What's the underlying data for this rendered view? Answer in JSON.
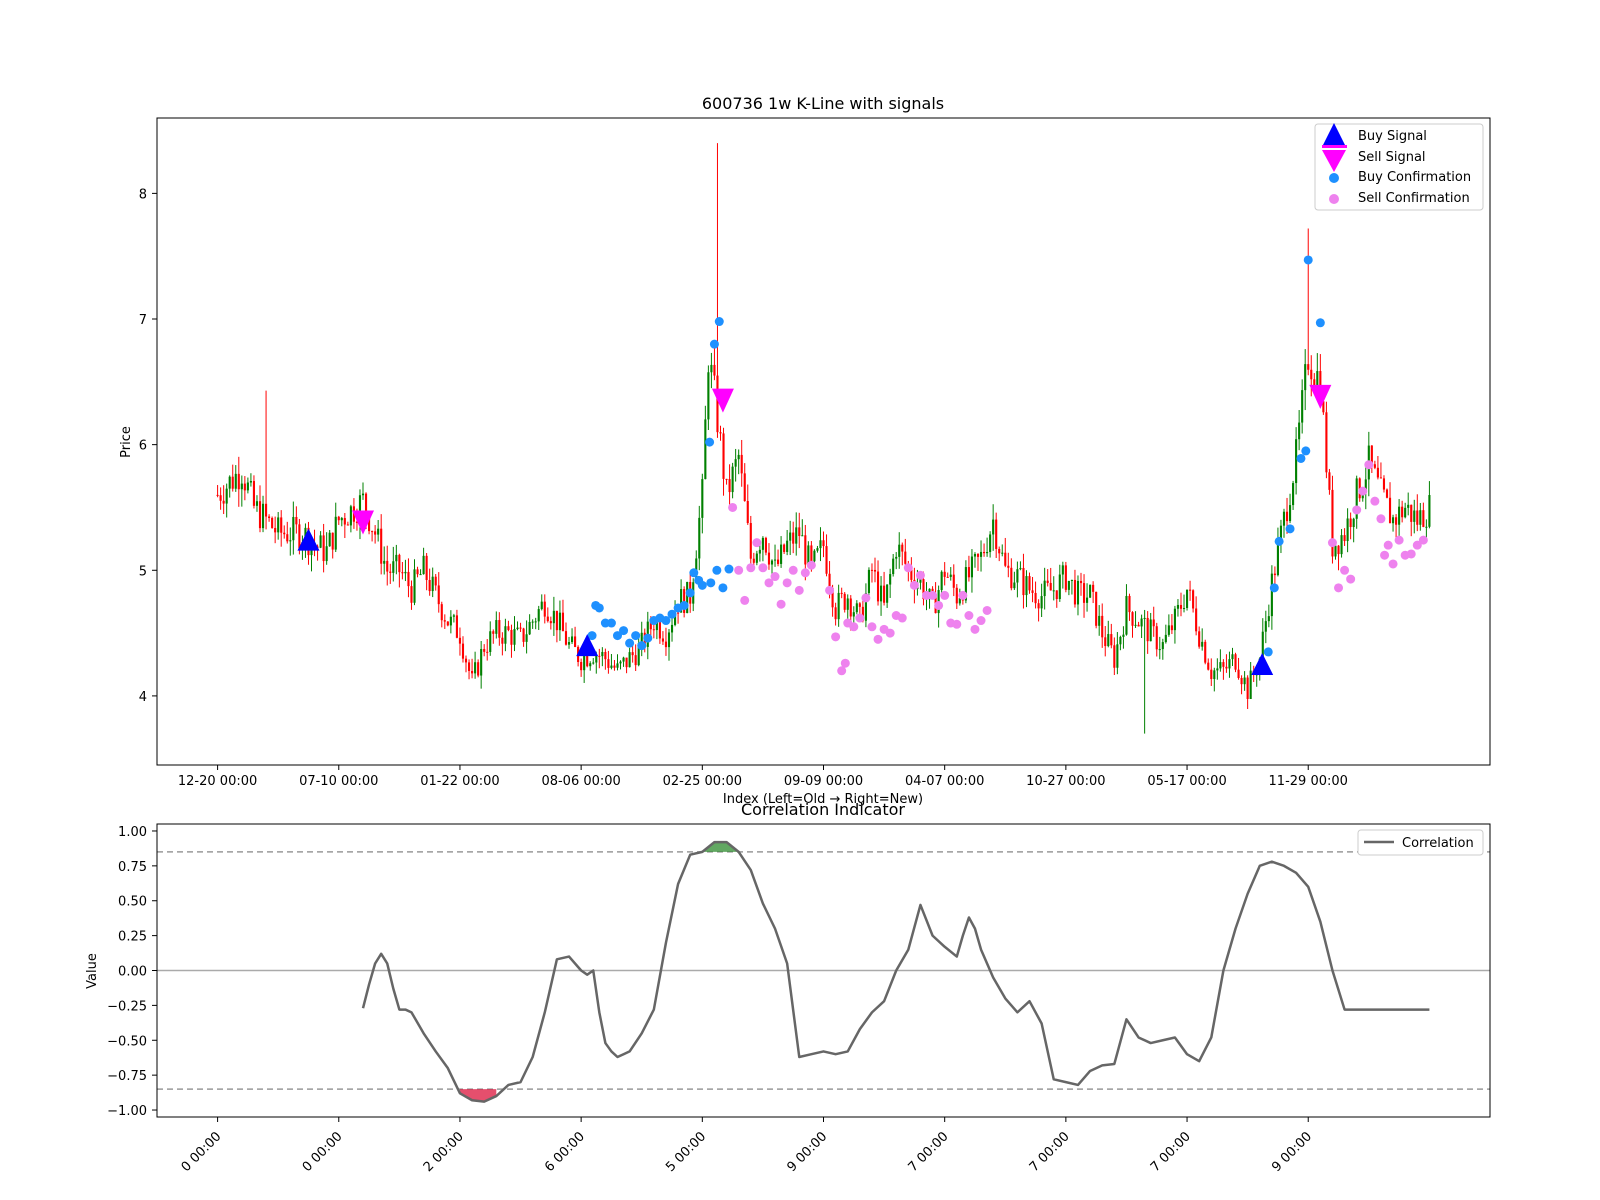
{
  "colors": {
    "up_candle": "#008000",
    "down_candle": "#ff0000",
    "buy_signal": "#0000ff",
    "sell_signal": "#ff00ff",
    "buy_confirmation": "#1e90ff",
    "sell_confirmation": "#ee82ee",
    "correlation_line": "#666666",
    "threshold_line": "#999999",
    "zero_line": "#aaaaaa",
    "high_fill": "#2e8b2e",
    "low_fill": "#dc143c"
  },
  "chart_data": [
    {
      "type": "candlestick",
      "title": "600736 1w K-Line with signals",
      "xlabel": "Index (Left=Old → Right=New)",
      "ylabel": "Price",
      "ylim": [
        3.45,
        8.6
      ],
      "xlim": [
        -5,
        105
      ],
      "yticks": [
        4,
        5,
        6,
        7,
        8
      ],
      "xtick_positions": [
        0,
        10,
        20,
        30,
        40,
        50,
        60,
        70,
        80,
        90
      ],
      "xtick_labels": [
        "12-20 00:00",
        "07-10 00:00",
        "01-22 00:00",
        "08-06 00:00",
        "02-25 00:00",
        "09-09 00:00",
        "04-07 00:00",
        "10-27 00:00",
        "05-17 00:00",
        "11-29 00:00"
      ],
      "close_anchors": [
        [
          0,
          5.6
        ],
        [
          2,
          5.8
        ],
        [
          3,
          5.5
        ],
        [
          5,
          5.3
        ],
        [
          7,
          5.3
        ],
        [
          8,
          5.2
        ],
        [
          9,
          5.15
        ],
        [
          10,
          5.4
        ],
        [
          12,
          5.55
        ],
        [
          13,
          5.3
        ],
        [
          14,
          5.0
        ],
        [
          15,
          5.0
        ],
        [
          16,
          4.85
        ],
        [
          17,
          5.0
        ],
        [
          18,
          4.8
        ],
        [
          19,
          4.6
        ],
        [
          20,
          4.5
        ],
        [
          21,
          4.1
        ],
        [
          22,
          4.4
        ],
        [
          23,
          4.5
        ],
        [
          24,
          4.5
        ],
        [
          25,
          4.45
        ],
        [
          26,
          4.6
        ],
        [
          27,
          4.75
        ],
        [
          28,
          4.6
        ],
        [
          29,
          4.4
        ],
        [
          30,
          4.3
        ],
        [
          31,
          4.35
        ],
        [
          32,
          4.3
        ],
        [
          33,
          4.2
        ],
        [
          34,
          4.3
        ],
        [
          35,
          4.4
        ],
        [
          36,
          4.6
        ],
        [
          37,
          4.5
        ],
        [
          38,
          4.75
        ],
        [
          39,
          4.8
        ],
        [
          40,
          5.6
        ],
        [
          40.5,
          6.7
        ],
        [
          41,
          6.4
        ],
        [
          41.5,
          6.0
        ],
        [
          42,
          5.6
        ],
        [
          43,
          5.9
        ],
        [
          44,
          5.1
        ],
        [
          45,
          5.3
        ],
        [
          46,
          5.0
        ],
        [
          47,
          5.2
        ],
        [
          48,
          5.3
        ],
        [
          49,
          5.0
        ],
        [
          50,
          5.2
        ],
        [
          51,
          4.7
        ],
        [
          52,
          4.8
        ],
        [
          53,
          4.6
        ],
        [
          54,
          5.0
        ],
        [
          55,
          4.7
        ],
        [
          56,
          5.2
        ],
        [
          57,
          5.0
        ],
        [
          58,
          4.9
        ],
        [
          59,
          4.7
        ],
        [
          60,
          5.0
        ],
        [
          61,
          4.8
        ],
        [
          62,
          4.95
        ],
        [
          63,
          5.1
        ],
        [
          64,
          5.4
        ],
        [
          65,
          5.0
        ],
        [
          66,
          4.95
        ],
        [
          67,
          4.85
        ],
        [
          68,
          4.8
        ],
        [
          69,
          4.85
        ],
        [
          70,
          4.95
        ],
        [
          71,
          4.8
        ],
        [
          72,
          4.8
        ],
        [
          73,
          4.5
        ],
        [
          74,
          4.3
        ],
        [
          75,
          4.7
        ],
        [
          76,
          4.6
        ],
        [
          77,
          4.5
        ],
        [
          78,
          4.4
        ],
        [
          79,
          4.6
        ],
        [
          80,
          4.85
        ],
        [
          81,
          4.5
        ],
        [
          82,
          4.2
        ],
        [
          83,
          4.2
        ],
        [
          84,
          4.3
        ],
        [
          85,
          4.05
        ],
        [
          86,
          4.3
        ],
        [
          87,
          4.9
        ],
        [
          88,
          5.4
        ],
        [
          89,
          5.9
        ],
        [
          90,
          6.7
        ],
        [
          91,
          6.5
        ],
        [
          92,
          5.2
        ],
        [
          93,
          5.3
        ],
        [
          94,
          5.6
        ],
        [
          95,
          5.85
        ],
        [
          96,
          5.6
        ],
        [
          97,
          5.4
        ],
        [
          98,
          5.5
        ],
        [
          99,
          5.4
        ],
        [
          100,
          5.5
        ]
      ],
      "spikes": [
        {
          "x": 4,
          "high": 6.43
        },
        {
          "x": 41.2,
          "high": 8.4
        },
        {
          "x": 90,
          "high": 7.72
        },
        {
          "x": 76.5,
          "low": 3.7
        }
      ],
      "buy_signals": [
        [
          7.5,
          5.22
        ],
        [
          30.5,
          4.38
        ],
        [
          86.2,
          4.23
        ]
      ],
      "sell_signals": [
        [
          12,
          5.38
        ],
        [
          41.7,
          6.35
        ],
        [
          91,
          6.38
        ]
      ],
      "buy_confirmation": [
        [
          31.2,
          4.72
        ],
        [
          31.5,
          4.7
        ],
        [
          32,
          4.58
        ],
        [
          32.5,
          4.58
        ],
        [
          33,
          4.48
        ],
        [
          33.5,
          4.52
        ],
        [
          34,
          4.42
        ],
        [
          34.5,
          4.48
        ],
        [
          35,
          4.4
        ],
        [
          35.5,
          4.46
        ],
        [
          36,
          4.6
        ],
        [
          36.5,
          4.62
        ],
        [
          37,
          4.6
        ],
        [
          37.5,
          4.65
        ],
        [
          38,
          4.7
        ],
        [
          38.5,
          4.72
        ],
        [
          39,
          4.82
        ],
        [
          39.3,
          4.98
        ],
        [
          39.7,
          4.92
        ],
        [
          40,
          4.88
        ],
        [
          40.7,
          4.9
        ],
        [
          41.2,
          5.0
        ],
        [
          41.7,
          4.86
        ],
        [
          42.2,
          5.01
        ],
        [
          40.6,
          6.02
        ],
        [
          41,
          6.8
        ],
        [
          41.4,
          6.98
        ],
        [
          87.2,
          4.86
        ],
        [
          87.6,
          5.23
        ],
        [
          88.5,
          5.33
        ],
        [
          89.4,
          5.89
        ],
        [
          89.8,
          5.95
        ],
        [
          90,
          7.47
        ],
        [
          91,
          6.97
        ],
        [
          30.9,
          4.48
        ],
        [
          86.7,
          4.35
        ]
      ],
      "sell_confirmation": [
        [
          42.5,
          5.5
        ],
        [
          43,
          5.0
        ],
        [
          43.5,
          4.76
        ],
        [
          44,
          5.02
        ],
        [
          44.5,
          5.22
        ],
        [
          45,
          5.02
        ],
        [
          45.5,
          4.9
        ],
        [
          46,
          4.95
        ],
        [
          46.5,
          4.73
        ],
        [
          47,
          4.9
        ],
        [
          47.5,
          5.0
        ],
        [
          48,
          4.84
        ],
        [
          48.5,
          4.98
        ],
        [
          49,
          5.04
        ],
        [
          50.5,
          4.84
        ],
        [
          51,
          4.47
        ],
        [
          51.5,
          4.2
        ],
        [
          51.8,
          4.26
        ],
        [
          52,
          4.58
        ],
        [
          52.5,
          4.55
        ],
        [
          53,
          4.62
        ],
        [
          53.5,
          4.78
        ],
        [
          54,
          4.55
        ],
        [
          54.5,
          4.45
        ],
        [
          55,
          4.53
        ],
        [
          55.5,
          4.5
        ],
        [
          56,
          4.64
        ],
        [
          56.5,
          4.62
        ],
        [
          57,
          5.02
        ],
        [
          57.5,
          4.88
        ],
        [
          58,
          4.96
        ],
        [
          58.5,
          4.8
        ],
        [
          59,
          4.8
        ],
        [
          59.5,
          4.72
        ],
        [
          60,
          4.8
        ],
        [
          60.5,
          4.58
        ],
        [
          61,
          4.57
        ],
        [
          61.5,
          4.8
        ],
        [
          62,
          4.64
        ],
        [
          62.5,
          4.53
        ],
        [
          63,
          4.6
        ],
        [
          63.5,
          4.68
        ],
        [
          92,
          5.22
        ],
        [
          92.5,
          4.86
        ],
        [
          93,
          5.0
        ],
        [
          93.5,
          4.93
        ],
        [
          94,
          5.48
        ],
        [
          94.5,
          5.63
        ],
        [
          95,
          5.84
        ],
        [
          95.5,
          5.55
        ],
        [
          96,
          5.41
        ],
        [
          96.3,
          5.12
        ],
        [
          96.6,
          5.2
        ],
        [
          97,
          5.05
        ],
        [
          97.5,
          5.24
        ],
        [
          98,
          5.12
        ],
        [
          98.5,
          5.13
        ],
        [
          99,
          5.2
        ],
        [
          99.5,
          5.24
        ]
      ],
      "legend": [
        "Buy Signal",
        "Sell Signal",
        "Buy Confirmation",
        "Sell Confirmation"
      ],
      "legend_position": "top-right"
    },
    {
      "type": "line",
      "title": "Correlation Indicator",
      "ylabel": "Value",
      "ylim": [
        -1.05,
        1.05
      ],
      "xlim": [
        -5,
        105
      ],
      "yticks": [
        1.0,
        0.75,
        0.5,
        0.25,
        0.0,
        -0.25,
        -0.5,
        -0.75,
        -1.0
      ],
      "ytick_labels": [
        "1.00",
        "0.75",
        "0.50",
        "0.25",
        "0.00",
        "−0.25",
        "−0.50",
        "−0.75",
        "−1.00"
      ],
      "xtick_positions": [
        0,
        10,
        20,
        30,
        40,
        50,
        60,
        70,
        80,
        90
      ],
      "xtick_labels": [
        "0 00:00",
        "0 00:00",
        "2 00:00",
        "6 00:00",
        "5 00:00",
        "9 00:00",
        "7 00:00",
        "7 00:00",
        "7 00:00",
        "9 00:00"
      ],
      "thresholds": [
        0.85,
        -0.85
      ],
      "series": [
        {
          "name": "Correlation",
          "x": [
            12,
            12.5,
            13,
            13.5,
            14,
            14.5,
            15,
            15.5,
            16,
            17,
            18,
            19,
            20,
            21,
            22,
            23,
            24,
            25,
            26,
            27,
            28,
            29,
            30,
            30.5,
            31,
            31.5,
            32,
            32.5,
            33,
            33.5,
            34,
            35,
            36,
            37,
            38,
            39,
            40,
            41,
            42,
            43,
            44,
            45,
            46,
            47,
            48,
            49,
            50,
            51,
            52,
            53,
            54,
            55,
            56,
            57,
            58,
            59,
            60,
            61,
            61.5,
            62,
            62.5,
            63,
            64,
            65,
            66,
            67,
            68,
            69,
            70,
            71,
            72,
            73,
            74,
            75,
            76,
            77,
            78,
            79,
            80,
            81,
            82,
            83,
            84,
            85,
            86,
            87,
            88,
            89,
            90,
            91,
            92,
            93,
            94,
            95,
            96,
            97,
            98,
            99,
            100
          ],
          "values": [
            -0.27,
            -0.1,
            0.05,
            0.12,
            0.05,
            -0.13,
            -0.28,
            -0.28,
            -0.3,
            -0.45,
            -0.58,
            -0.7,
            -0.88,
            -0.93,
            -0.94,
            -0.9,
            -0.82,
            -0.8,
            -0.62,
            -0.3,
            0.08,
            0.1,
            0.0,
            -0.03,
            0.0,
            -0.3,
            -0.52,
            -0.58,
            -0.62,
            -0.6,
            -0.58,
            -0.45,
            -0.28,
            0.2,
            0.62,
            0.83,
            0.85,
            0.92,
            0.92,
            0.85,
            0.72,
            0.48,
            0.3,
            0.05,
            -0.62,
            -0.6,
            -0.58,
            -0.6,
            -0.58,
            -0.42,
            -0.3,
            -0.22,
            0.0,
            0.15,
            0.47,
            0.25,
            0.17,
            0.1,
            0.25,
            0.38,
            0.3,
            0.15,
            -0.05,
            -0.2,
            -0.3,
            -0.22,
            -0.38,
            -0.78,
            -0.8,
            -0.82,
            -0.72,
            -0.68,
            -0.67,
            -0.35,
            -0.48,
            -0.52,
            -0.5,
            -0.48,
            -0.6,
            -0.65,
            -0.48,
            0.0,
            0.3,
            0.55,
            0.75,
            0.78,
            0.75,
            0.7,
            0.6,
            0.35,
            0.0,
            -0.28,
            -0.28,
            -0.28,
            -0.28,
            -0.28,
            -0.28,
            -0.28,
            -0.28
          ]
        }
      ],
      "legend": [
        "Correlation"
      ],
      "legend_position": "top-right"
    }
  ]
}
